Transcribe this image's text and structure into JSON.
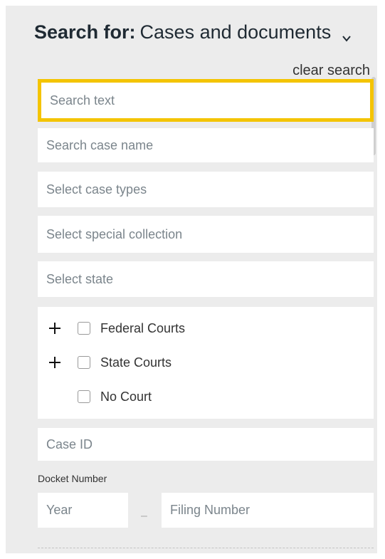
{
  "header": {
    "label": "Search for:",
    "value": "Cases and documents",
    "chevron_icon": "chevron-down-icon"
  },
  "clear_search": "clear search",
  "fields": {
    "search_text": {
      "placeholder": "Search text"
    },
    "case_name": {
      "placeholder": "Search case name"
    },
    "case_types": {
      "placeholder": "Select case types"
    },
    "special_collection": {
      "placeholder": "Select special collection"
    },
    "state": {
      "placeholder": "Select state"
    },
    "case_id": {
      "placeholder": "Case ID"
    },
    "year": {
      "placeholder": "Year"
    },
    "filing_number": {
      "placeholder": "Filing Number"
    }
  },
  "courts": [
    {
      "label": "Federal Courts",
      "expandable": true,
      "checked": false
    },
    {
      "label": "State Courts",
      "expandable": true,
      "checked": false
    },
    {
      "label": "No Court",
      "expandable": false,
      "checked": false
    }
  ],
  "docket": {
    "title": "Docket Number",
    "separator": "–"
  },
  "colors": {
    "focus_border": "#f4c400",
    "panel_bg": "#ececec",
    "placeholder": "#7b858c"
  }
}
